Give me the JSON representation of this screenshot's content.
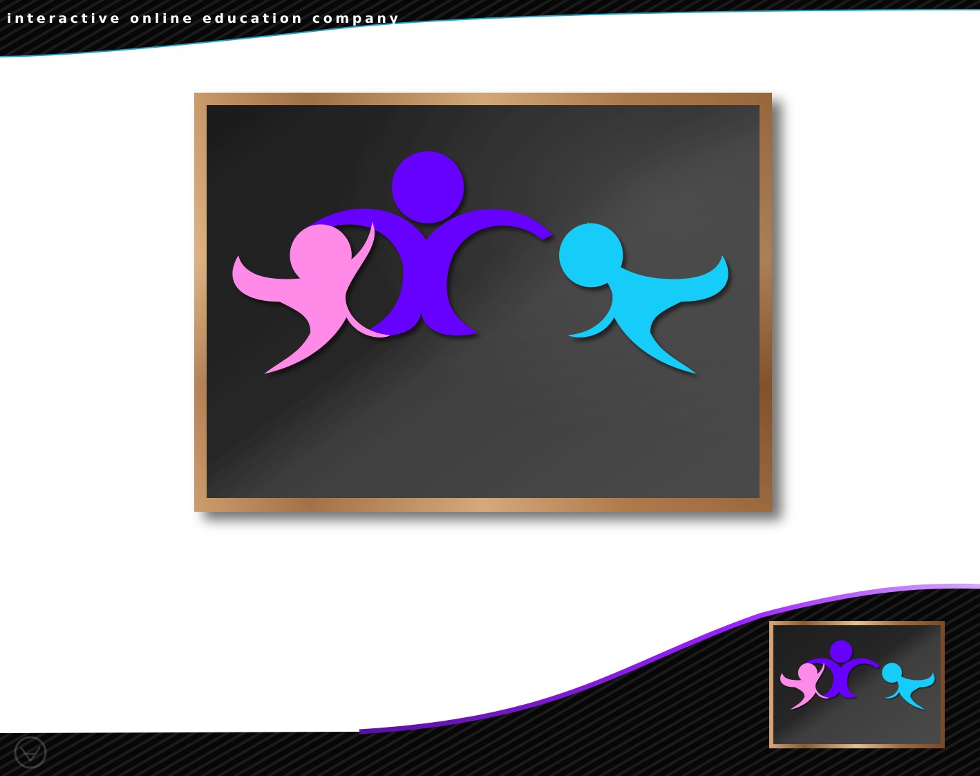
{
  "header": {
    "tagline": "interactive online education company"
  },
  "colors": {
    "band": "#050505",
    "accent_violet": "#a020f0",
    "accent_cyan": "#19a7c7",
    "frame_gold": "#c89a6a",
    "board": "#2a2a2a",
    "figure_center": "#6600ff",
    "figure_left": "#ff8ae8",
    "figure_right": "#12ccf8"
  },
  "main_logo": {
    "figures": [
      "pink-figure",
      "violet-figure",
      "cyan-figure"
    ]
  },
  "thumbnail_logo": {
    "figures": [
      "pink-figure",
      "violet-figure",
      "cyan-figure"
    ]
  },
  "corner_emblem": {
    "icon": "faint-emblem-icon"
  }
}
